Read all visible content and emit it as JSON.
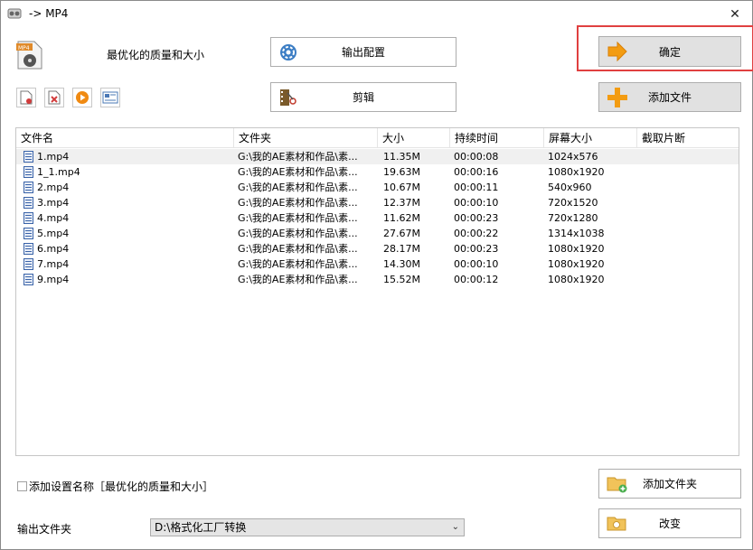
{
  "window": {
    "title": "-> MP4",
    "close_glyph": "✕"
  },
  "quality_label": "最优化的质量和大小",
  "buttons": {
    "output_config": "输出配置",
    "edit": "剪辑",
    "ok": "确定",
    "add_file": "添加文件",
    "add_folder": "添加文件夹",
    "change": "改变"
  },
  "toolbar_icons": [
    "remove-file-icon",
    "clear-list-icon",
    "play-icon",
    "media-info-icon"
  ],
  "table": {
    "columns": [
      "文件名",
      "文件夹",
      "大小",
      "持续时间",
      "屏幕大小",
      "截取片断"
    ],
    "rows": [
      [
        "1.mp4",
        "G:\\我的AE素材和作品\\素...",
        "11.35M",
        "00:00:08",
        "1024x576",
        ""
      ],
      [
        "1_1.mp4",
        "G:\\我的AE素材和作品\\素...",
        "19.63M",
        "00:00:16",
        "1080x1920",
        ""
      ],
      [
        "2.mp4",
        "G:\\我的AE素材和作品\\素...",
        "10.67M",
        "00:00:11",
        "540x960",
        ""
      ],
      [
        "3.mp4",
        "G:\\我的AE素材和作品\\素...",
        "12.37M",
        "00:00:10",
        "720x1520",
        ""
      ],
      [
        "4.mp4",
        "G:\\我的AE素材和作品\\素...",
        "11.62M",
        "00:00:23",
        "720x1280",
        ""
      ],
      [
        "5.mp4",
        "G:\\我的AE素材和作品\\素...",
        "27.67M",
        "00:00:22",
        "1314x1038",
        ""
      ],
      [
        "6.mp4",
        "G:\\我的AE素材和作品\\素...",
        "28.17M",
        "00:00:23",
        "1080x1920",
        ""
      ],
      [
        "7.mp4",
        "G:\\我的AE素材和作品\\素...",
        "14.30M",
        "00:00:10",
        "1080x1920",
        ""
      ],
      [
        "9.mp4",
        "G:\\我的AE素材和作品\\素...",
        "15.52M",
        "00:00:12",
        "1080x1920",
        ""
      ]
    ]
  },
  "settings": {
    "add_name_checkbox_label": "添加设置名称［最优化的质量和大小］",
    "add_name_checked": false,
    "output_folder_label": "输出文件夹",
    "output_folder_value": "D:\\格式化工厂转换"
  },
  "colors": {
    "highlight": "#e04040",
    "accent_orange": "#f39c12"
  }
}
